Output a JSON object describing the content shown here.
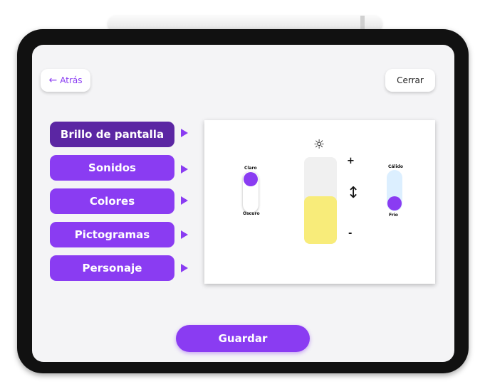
{
  "nav": {
    "back_label": "Atrás",
    "back_arrow": "←",
    "close_label": "Cerrar"
  },
  "menu": {
    "items": [
      {
        "label": "Brillo de pantalla",
        "active": true
      },
      {
        "label": "Sonidos",
        "active": false
      },
      {
        "label": "Colores",
        "active": false
      },
      {
        "label": "Pictogramas",
        "active": false
      },
      {
        "label": "Personaje",
        "active": false
      }
    ]
  },
  "panel": {
    "mode_toggle": {
      "top_label": "Claro",
      "bottom_label": "Oscuro",
      "selected": "Claro"
    },
    "brightness": {
      "icon": "sun-icon",
      "glyph": "☼",
      "plus": "+",
      "minus": "-",
      "level": 0.55
    },
    "temp_toggle": {
      "top_label": "Cálido",
      "bottom_label": "Frío",
      "selected": "Frío"
    }
  },
  "footer": {
    "save_label": "Guardar"
  },
  "colors": {
    "accent": "#8a3cf2",
    "accent_dark": "#5b26a3",
    "brightness_fill": "#f8ec7a",
    "warm_track": "#dcefff"
  }
}
